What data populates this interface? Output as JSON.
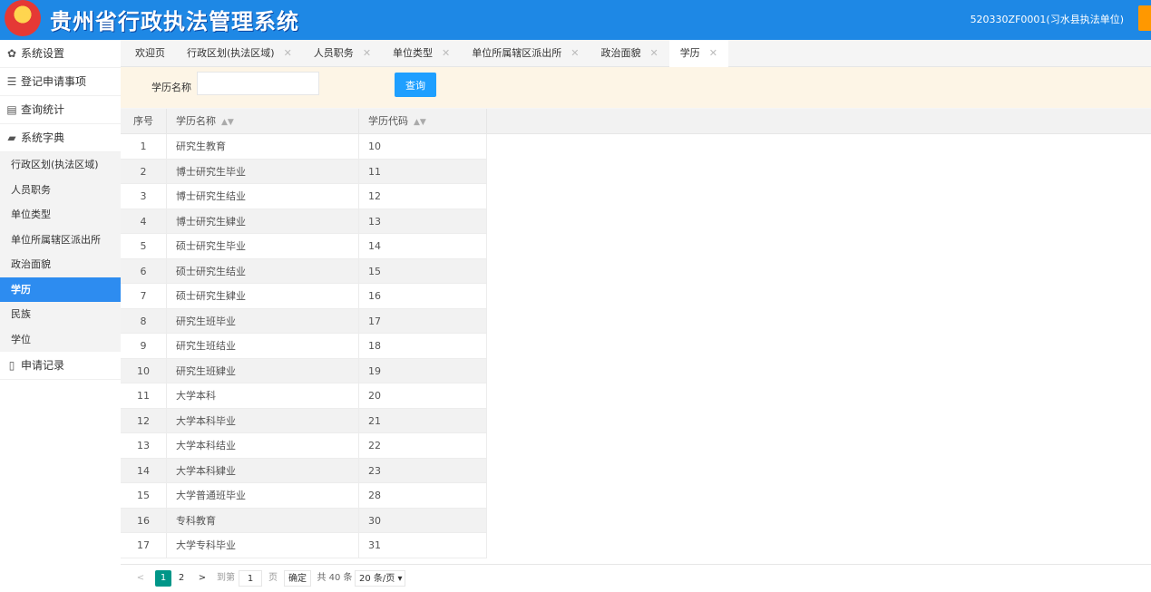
{
  "header": {
    "title": "贵州省行政执法管理系统",
    "user": "520330ZF0001(习水县执法单位)"
  },
  "sidebar": {
    "groups": [
      {
        "label": "系统设置",
        "icon": "gear-icon"
      },
      {
        "label": "登记申请事项",
        "icon": "sliders-icon"
      },
      {
        "label": "查询统计",
        "icon": "database-icon"
      },
      {
        "label": "系统字典",
        "icon": "book-icon"
      }
    ],
    "dict_items": [
      "行政区划(执法区域)",
      "人员职务",
      "单位类型",
      "单位所属辖区派出所",
      "政治面貌",
      "学历",
      "民族",
      "学位"
    ],
    "active_item": "学历",
    "last_group": {
      "label": "申请记录",
      "icon": "document-icon"
    }
  },
  "tabs": [
    "欢迎页",
    "行政区划(执法区域)",
    "人员职务",
    "单位类型",
    "单位所属辖区派出所",
    "政治面貌",
    "学历"
  ],
  "active_tab": "学历",
  "search": {
    "label": "学历名称",
    "value": "",
    "placeholder": "",
    "button": "查询"
  },
  "table": {
    "columns": [
      "序号",
      "学历名称",
      "学历代码"
    ],
    "rows": [
      [
        "1",
        "研究生教育",
        "10"
      ],
      [
        "2",
        "博士研究生毕业",
        "11"
      ],
      [
        "3",
        "博士研究生结业",
        "12"
      ],
      [
        "4",
        "博士研究生肄业",
        "13"
      ],
      [
        "5",
        "硕士研究生毕业",
        "14"
      ],
      [
        "6",
        "硕士研究生结业",
        "15"
      ],
      [
        "7",
        "硕士研究生肄业",
        "16"
      ],
      [
        "8",
        "研究生班毕业",
        "17"
      ],
      [
        "9",
        "研究生班结业",
        "18"
      ],
      [
        "10",
        "研究生班肄业",
        "19"
      ],
      [
        "11",
        "大学本科",
        "20"
      ],
      [
        "12",
        "大学本科毕业",
        "21"
      ],
      [
        "13",
        "大学本科结业",
        "22"
      ],
      [
        "14",
        "大学本科肄业",
        "23"
      ],
      [
        "15",
        "大学普通班毕业",
        "28"
      ],
      [
        "16",
        "专科教育",
        "30"
      ],
      [
        "17",
        "大学专科毕业",
        "31"
      ]
    ]
  },
  "pager": {
    "pages": [
      "1",
      "2"
    ],
    "current": "1",
    "goto_label": "到第",
    "goto_value": "1",
    "page_label": "页",
    "confirm": "确定",
    "total": "共 40 条",
    "page_size": "20 条/页"
  }
}
